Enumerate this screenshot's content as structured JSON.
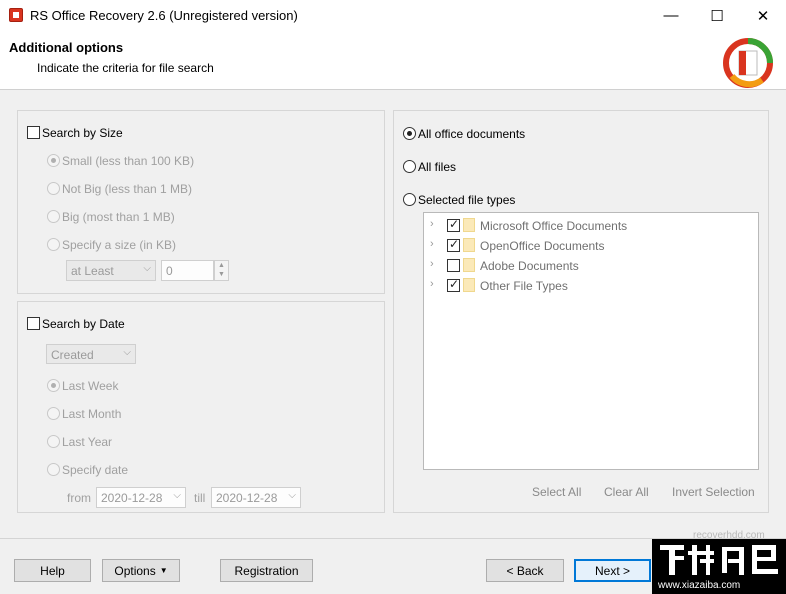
{
  "window": {
    "title": "RS Office Recovery 2.6 (Unregistered version)",
    "controls": {
      "minimize": "—",
      "maximize": "☐",
      "close": "✕"
    }
  },
  "header": {
    "title": "Additional options",
    "subtitle": "Indicate the criteria for file search"
  },
  "size_group": {
    "checkbox_label": "Search by Size",
    "checked": false,
    "options": [
      "Small (less than 100 KB)",
      "Not Big (less than 1 MB)",
      "Big (most than 1 MB)",
      "Specify a size (in KB)"
    ],
    "selected_option": "Small (less than 100 KB)",
    "comparator_value": "at Least",
    "size_value": "0"
  },
  "date_group": {
    "checkbox_label": "Search by Date",
    "checked": false,
    "date_type_value": "Created",
    "options": [
      "Last Week",
      "Last Month",
      "Last Year",
      "Specify date"
    ],
    "selected_option": "Last Week",
    "from_label": "from",
    "from_value": "2020-12-28",
    "till_label": "till",
    "till_value": "2020-12-28"
  },
  "file_types": {
    "radio_all_office": "All office documents",
    "radio_all_files": "All files",
    "radio_selected_types": "Selected file types",
    "selected_radio": "All office documents",
    "tree": [
      {
        "label": "Microsoft Office Documents",
        "checked": true
      },
      {
        "label": "OpenOffice Documents",
        "checked": true
      },
      {
        "label": "Adobe Documents",
        "checked": false
      },
      {
        "label": "Other File Types",
        "checked": true
      }
    ],
    "select_all": "Select All",
    "clear_all": "Clear All",
    "invert_selection": "Invert Selection"
  },
  "footer": {
    "help": "Help",
    "options": "Options",
    "registration": "Registration",
    "back": "< Back",
    "next": "Next >"
  },
  "watermark": {
    "faint_url": "recoverhdd.com",
    "site": "www.xiazaiba.com"
  },
  "colors": {
    "accent": "#0078d7",
    "logo_red": "#d9341f",
    "logo_orange": "#f39c12"
  }
}
